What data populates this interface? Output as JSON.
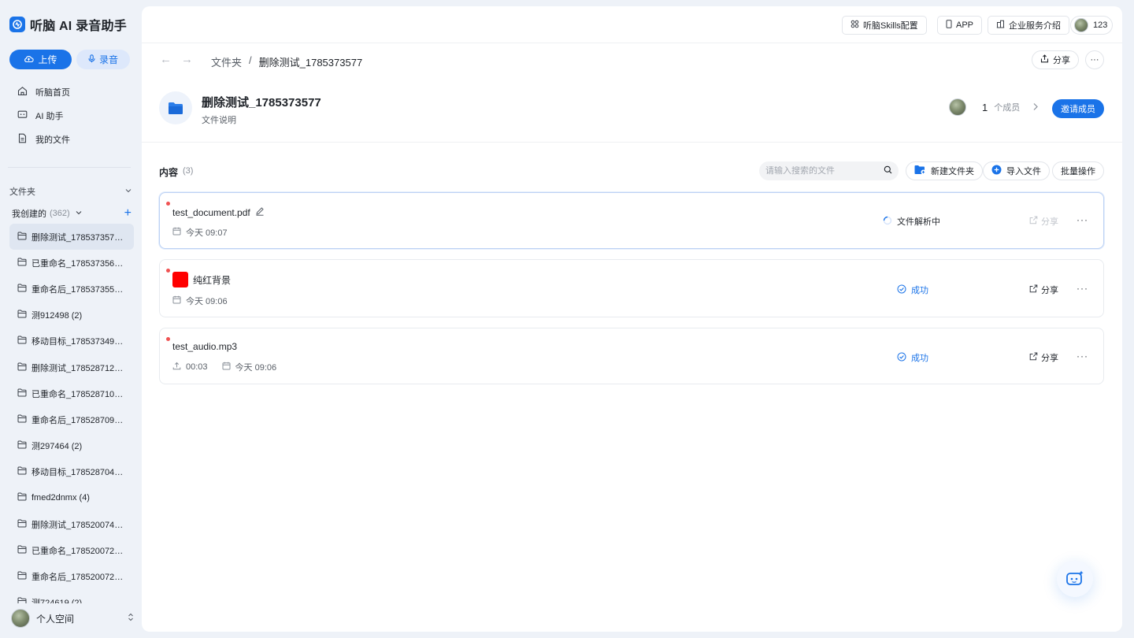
{
  "app": {
    "name": "听脑 AI 录音助手"
  },
  "sidebar": {
    "upload_label": "上传",
    "record_label": "录音",
    "nav": [
      {
        "label": "听脑首页",
        "icon": "home-icon"
      },
      {
        "label": "AI 助手",
        "icon": "ai-chat-icon"
      },
      {
        "label": "我的文件",
        "icon": "file-icon"
      }
    ],
    "folder_section_label": "文件夹",
    "created_label": "我创建的",
    "created_count": "(362)",
    "folders": [
      "删除测试_1785373577 ...",
      "已重命名_1785373562 ...",
      "重命名后_1785373552 ...",
      "测912498 (2)",
      "移动目标_1785373497 ...",
      "删除测试_1785287120 ...",
      "已重命名_1785287107 (...",
      "重命名后_1785287096 ...",
      "测297464 (2)",
      "移动目标_1785287046 ...",
      "fmed2dnmx (4)",
      "删除测试_1785200743 ...",
      "已重命名_1785200729 ...",
      "重命名后_1785200720 ...",
      "测724619 (2)"
    ],
    "profile_label": "个人空间"
  },
  "topbar": {
    "skills_label": "听脑Skills配置",
    "app_label": "APP",
    "enterprise_label": "企业服务介绍",
    "user_name": "123"
  },
  "breadcrumb": {
    "parent": "文件夹",
    "separator": "/",
    "current": "删除测试_1785373577"
  },
  "actions": {
    "share_label": "分享",
    "more_label": "···"
  },
  "folder": {
    "title": "删除测试_1785373577",
    "description": "文件说明",
    "member_count": "1",
    "member_label": "个成员",
    "invite_label": "邀请成员"
  },
  "content": {
    "title": "内容",
    "count": "(3)",
    "search_placeholder": "请输入搜索的文件",
    "new_folder_label": "新建文件夹",
    "import_label": "导入文件",
    "batch_label": "批量操作"
  },
  "files": [
    {
      "name": "test_document.pdf",
      "date": "今天 09:07",
      "status": "文件解析中",
      "share": "分享",
      "more": "···"
    },
    {
      "name": "纯红背景",
      "date": "今天 09:06",
      "status": "成功",
      "share": "分享",
      "more": "···",
      "thumb_color": "#ff0000"
    },
    {
      "name": "test_audio.mp3",
      "duration": "00:03",
      "date": "今天 09:06",
      "status": "成功",
      "share": "分享",
      "more": "···"
    }
  ],
  "colors": {
    "accent": "#1a73e8",
    "unread_dot": "#f05252",
    "success": "#1a73e8"
  }
}
